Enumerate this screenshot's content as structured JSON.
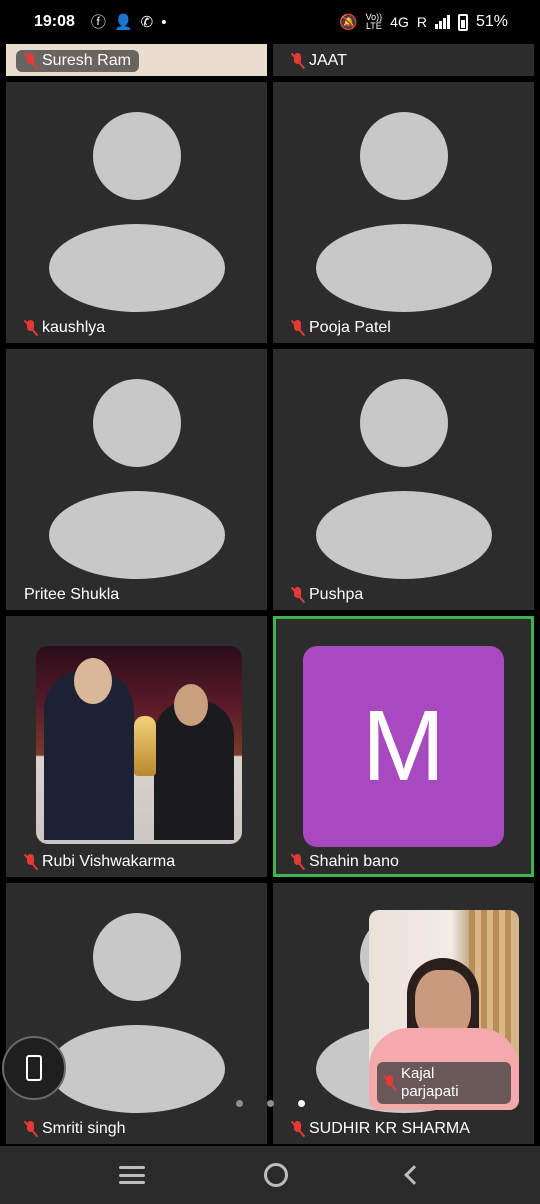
{
  "status_bar": {
    "time": "19:08",
    "network": "4G",
    "roaming": "R",
    "volte_top": "Vo))",
    "volte_bottom": "LTE",
    "battery": "51%"
  },
  "participants": [
    {
      "name": "Suresh Ram",
      "muted": true
    },
    {
      "name": "JAAT",
      "muted": true
    },
    {
      "name": "kaushlya",
      "muted": true
    },
    {
      "name": "Pooja Patel",
      "muted": true
    },
    {
      "name": "Pritee Shukla",
      "muted": false
    },
    {
      "name": "Pushpa",
      "muted": true
    },
    {
      "name": "Rubi Vishwakarma",
      "muted": true
    },
    {
      "name": "Shahin bano",
      "muted": true,
      "avatar_letter": "M",
      "avatar_color": "#a849c0",
      "active_speaker": true
    },
    {
      "name": "Smriti singh",
      "muted": true
    },
    {
      "name": "SUDHIR KR SHARMA",
      "muted": true
    }
  ],
  "self_view": {
    "name_line1": "Kajal",
    "name_line2": "parjapati",
    "muted": true
  },
  "pagination": {
    "total": 3,
    "current": 3
  },
  "colors": {
    "tile_bg": "#2c2c2c",
    "active_border": "#3fb34f",
    "muted_icon": "#e53935"
  }
}
